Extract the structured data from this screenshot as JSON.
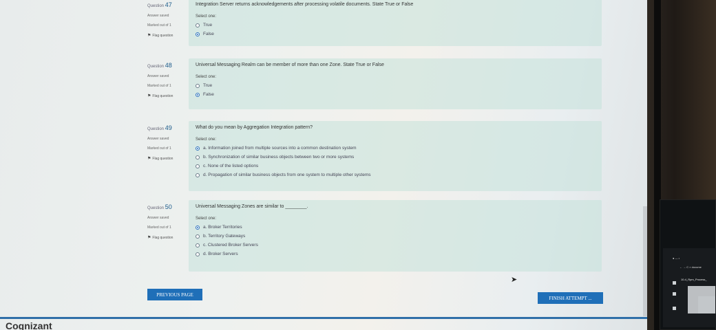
{
  "questions": [
    {
      "number_prefix": "Question",
      "number": "47",
      "status": "Answer saved",
      "marked": "Marked out of 1",
      "flag_label": "Flag question",
      "text": "Integration Server returns acknowledgements after processing volatile documents. State True or False",
      "select_one": "Select one:",
      "options": [
        {
          "label": "True",
          "checked": false
        },
        {
          "label": "False",
          "checked": true
        }
      ]
    },
    {
      "number_prefix": "Question",
      "number": "48",
      "status": "Answer saved",
      "marked": "Marked out of 1",
      "flag_label": "Flag question",
      "text": "Universal Messaging Realm can be member of more than one Zone. State True or False",
      "select_one": "Select one:",
      "options": [
        {
          "label": "True",
          "checked": false
        },
        {
          "label": "False",
          "checked": true
        }
      ]
    },
    {
      "number_prefix": "Question",
      "number": "49",
      "status": "Answer saved",
      "marked": "Marked out of 1",
      "flag_label": "Flag question",
      "text": "What do you mean by Aggregation Integration pattern?",
      "select_one": "Select one:",
      "options": [
        {
          "label": "a. Information joined from multiple sources into a common destination system",
          "checked": true
        },
        {
          "label": "b. Synchronization of similar business objects between two or more systems",
          "checked": false
        },
        {
          "label": "c. None of the listed options",
          "checked": false
        },
        {
          "label": "d. Propagation of similar business objects from one system to multiple other systems",
          "checked": false
        }
      ]
    },
    {
      "number_prefix": "Question",
      "number": "50",
      "status": "Answer saved",
      "marked": "Marked out of 1",
      "flag_label": "Flag question",
      "text": "Universal Messaging Zones are similar to ________.",
      "select_one": "Select one:",
      "options": [
        {
          "label": "a. Broker Territories",
          "checked": true
        },
        {
          "label": "b. Territory Gateways",
          "checked": false
        },
        {
          "label": "c. Clustered Broker Servers",
          "checked": false
        },
        {
          "label": "d. Broker Servers",
          "checked": false
        }
      ]
    }
  ],
  "buttons": {
    "previous": "PREVIOUS PAGE",
    "finish": "FINISH ATTEMPT ..."
  },
  "brand": "Cognizant",
  "side_monitor": {
    "nav_text": "← → C × docume",
    "tab_text": "● — •",
    "title_text": "10-4_Rpm_Process_"
  },
  "colors": {
    "accent": "#1f6fb8",
    "question_bg": "#c4e2da",
    "divider": "#2f6fa8"
  }
}
